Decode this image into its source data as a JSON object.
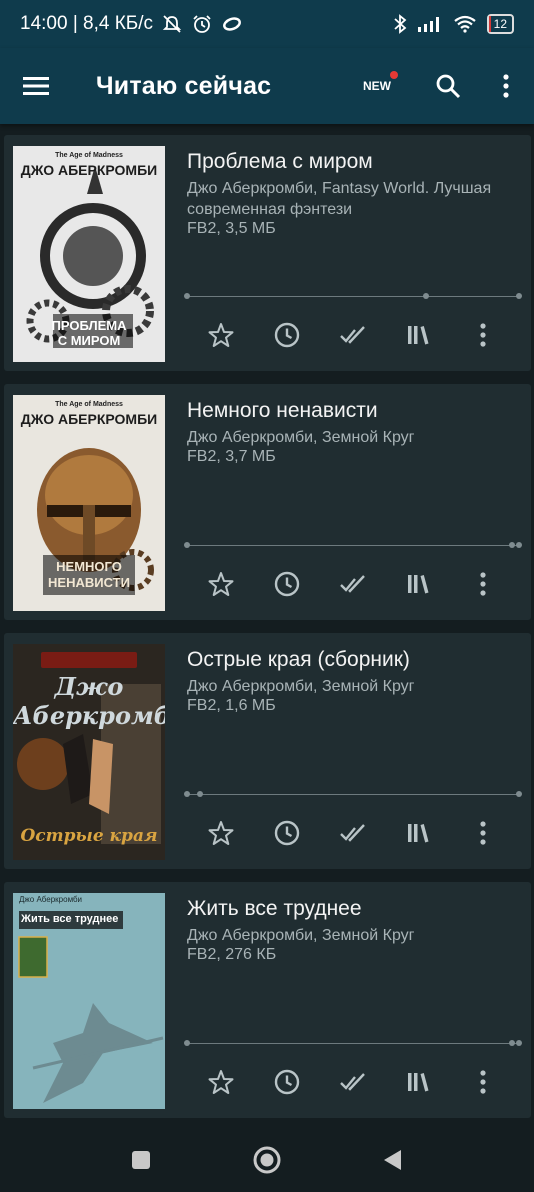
{
  "status_bar": {
    "time_info": "14:00 | 8,4 КБ/с",
    "battery": "12"
  },
  "app_bar": {
    "title": "Читаю сейчас",
    "new_label": "NEW"
  },
  "books": [
    {
      "title": "Проблема с миром",
      "author": "Джо Аберкромби, Fantasy World. Лучшая современная фэнтези",
      "meta": "FB2, 3,5 МБ",
      "progress": 0.72,
      "cover": {
        "series": "The Age of Madness",
        "author": "ДЖО АБЕРКРОМБИ",
        "title_lines": [
          "ПРОБЛЕМА",
          "С МИРОМ"
        ],
        "bg": "#e8e8e8",
        "accent": "#1f1f1f"
      }
    },
    {
      "title": "Немного ненависти",
      "author": "Джо Аберкромби, Земной Круг",
      "meta": "FB2, 3,7 МБ",
      "progress": 0.98,
      "cover": {
        "series": "The Age of Madness",
        "author": "ДЖО АБЕРКРОМБИ",
        "title_lines": [
          "НЕМНОГО",
          "НЕНАВИСТИ"
        ],
        "bg": "#e9e6df",
        "accent": "#7a4a22"
      }
    },
    {
      "title": "Острые края (сборник)",
      "author": "Джо Аберкромби, Земной Круг",
      "meta": "FB2, 1,6 МБ",
      "progress": 0.04,
      "cover": {
        "series": "",
        "author": "Джо Аберкромби",
        "title_lines": [
          "Острые края"
        ],
        "bg": "#2a2723",
        "accent": "#d9a441"
      }
    },
    {
      "title": "Жить все труднее",
      "author": "Джо Аберкромби, Земной Круг",
      "meta": "FB2, 276 КБ",
      "progress": 0.98,
      "cover": {
        "series": "",
        "author": "Джо Аберкромби",
        "title_lines": [
          "Жить все труднее"
        ],
        "bg": "#86b4bc",
        "accent": "#4d6b70"
      }
    }
  ],
  "colors": {
    "appbar": "#0f3b4c",
    "card": "#202d31",
    "icon": "#b9c4c7"
  },
  "action_icons": [
    "star-icon",
    "clock-icon",
    "double-check-icon",
    "library-icon",
    "more-vertical-icon"
  ]
}
